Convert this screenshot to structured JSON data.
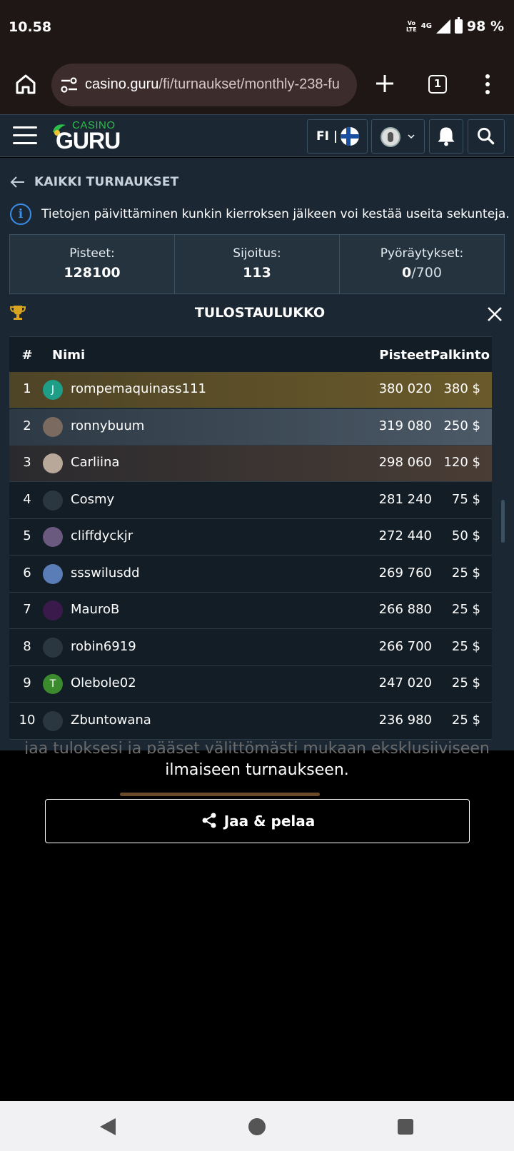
{
  "status": {
    "time": "10.58",
    "volte_top": "Vo",
    "volte_bottom": "LTE",
    "net": "4G",
    "battery": "98 %"
  },
  "browser": {
    "url_host": "casino.guru",
    "url_path": "/fi/turnaukset/monthly-238-fu",
    "tab_count": "1"
  },
  "site": {
    "logo_casino": "CASINO",
    "logo_guru": "GURU",
    "lang": "FI |"
  },
  "nav": {
    "back_label": "KAIKKI TURNAUKSET"
  },
  "info": {
    "text": "Tietojen päivittäminen kunkin kierroksen jälkeen voi kestää useita sekunteja."
  },
  "stats": {
    "points_label": "Pisteet:",
    "points_value": "128100",
    "rank_label": "Sijoitus:",
    "rank_value": "113",
    "spins_label": "Pyöräytykset:",
    "spins_done": "0",
    "spins_total": "/700"
  },
  "leaderboard": {
    "title": "TULOSTAULUKKO",
    "headers": {
      "rank": "#",
      "name": "Nimi",
      "points": "Pisteet",
      "prize": "Palkinto"
    },
    "rows": [
      {
        "rank": "1",
        "name": "rompemaquinass111",
        "points": "380 020",
        "prize": "380 $",
        "avatar_letter": "J",
        "avatar_color": "#1e9e86"
      },
      {
        "rank": "2",
        "name": "ronnybuum",
        "points": "319 080",
        "prize": "250 $",
        "avatar_letter": "",
        "avatar_color": "#7a6a60"
      },
      {
        "rank": "3",
        "name": "Carliina",
        "points": "298 060",
        "prize": "120 $",
        "avatar_letter": "",
        "avatar_color": "#b8a89a"
      },
      {
        "rank": "4",
        "name": "Cosmy",
        "points": "281 240",
        "prize": "75 $",
        "avatar_letter": "",
        "avatar_color": "#2a3640"
      },
      {
        "rank": "5",
        "name": "cliffdyckjr",
        "points": "272 440",
        "prize": "50 $",
        "avatar_letter": "",
        "avatar_color": "#6b5a80"
      },
      {
        "rank": "6",
        "name": "ssswilusdd",
        "points": "269 760",
        "prize": "25 $",
        "avatar_letter": "",
        "avatar_color": "#5a7db8"
      },
      {
        "rank": "7",
        "name": "MauroB",
        "points": "266 880",
        "prize": "25 $",
        "avatar_letter": "",
        "avatar_color": "#3a1a4a"
      },
      {
        "rank": "8",
        "name": "robin6919",
        "points": "266 700",
        "prize": "25 $",
        "avatar_letter": "",
        "avatar_color": "#2a3640"
      },
      {
        "rank": "9",
        "name": "Olebole02",
        "points": "247 020",
        "prize": "25 $",
        "avatar_letter": "T",
        "avatar_color": "#3c8a2e"
      },
      {
        "rank": "10",
        "name": "Zbuntowana",
        "points": "236 980",
        "prize": "25 $",
        "avatar_letter": "",
        "avatar_color": "#2a3640"
      }
    ]
  },
  "promo": {
    "faded_text": "jaa tuloksesi ja pääset välittömästi mukaan eksklusiiviseen",
    "text": "ilmaiseen turnaukseen.",
    "share_button": "Jaa & pelaa"
  }
}
